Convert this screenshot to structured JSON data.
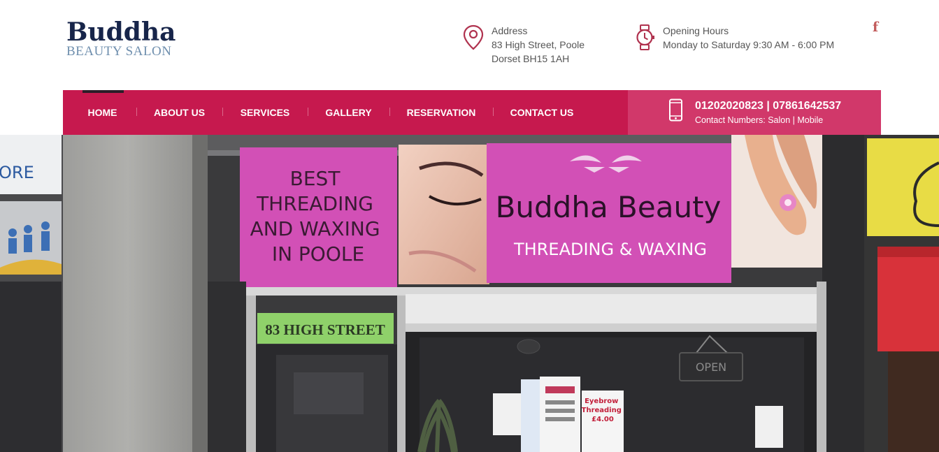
{
  "logo": {
    "main": "Buddha",
    "sub": "BEAUTY SALON"
  },
  "address": {
    "label": "Address",
    "line1": "83 High Street, Poole",
    "line2": "Dorset BH15 1AH",
    "icon": "map-pin-icon"
  },
  "hours": {
    "label": "Opening Hours",
    "text": "Monday to Saturday 9:30 AM - 6:00 PM",
    "icon": "watch-icon"
  },
  "social": {
    "facebook": "f"
  },
  "nav": {
    "items": [
      "HOME",
      "ABOUT US",
      "SERVICES",
      "GALLERY",
      "RESERVATION",
      "CONTACT US"
    ],
    "active": "HOME"
  },
  "contact": {
    "numbers": "01202020823 | 07861642537",
    "label": "Contact Numbers: Salon | Mobile",
    "icon": "mobile-phone-icon"
  },
  "hero": {
    "sign_left": [
      "BEST",
      "THREADING",
      "AND WAXING",
      "IN POOLE"
    ],
    "sign_title": "Buddha Beauty",
    "sign_subtitle": "THREADING & WAXING",
    "street_sign": "83 HIGH STREET",
    "left_shop_text": "ORE",
    "door_sign": "OPEN",
    "poster_text": [
      "Eyebrow",
      "Threading",
      "£4.00"
    ]
  },
  "colors": {
    "brand_navy": "#17254a",
    "nav_bg": "#c6194e",
    "contact_bg": "#d1386a",
    "icon_accent": "#b0334f",
    "sign_pink": "#d04fb4"
  }
}
